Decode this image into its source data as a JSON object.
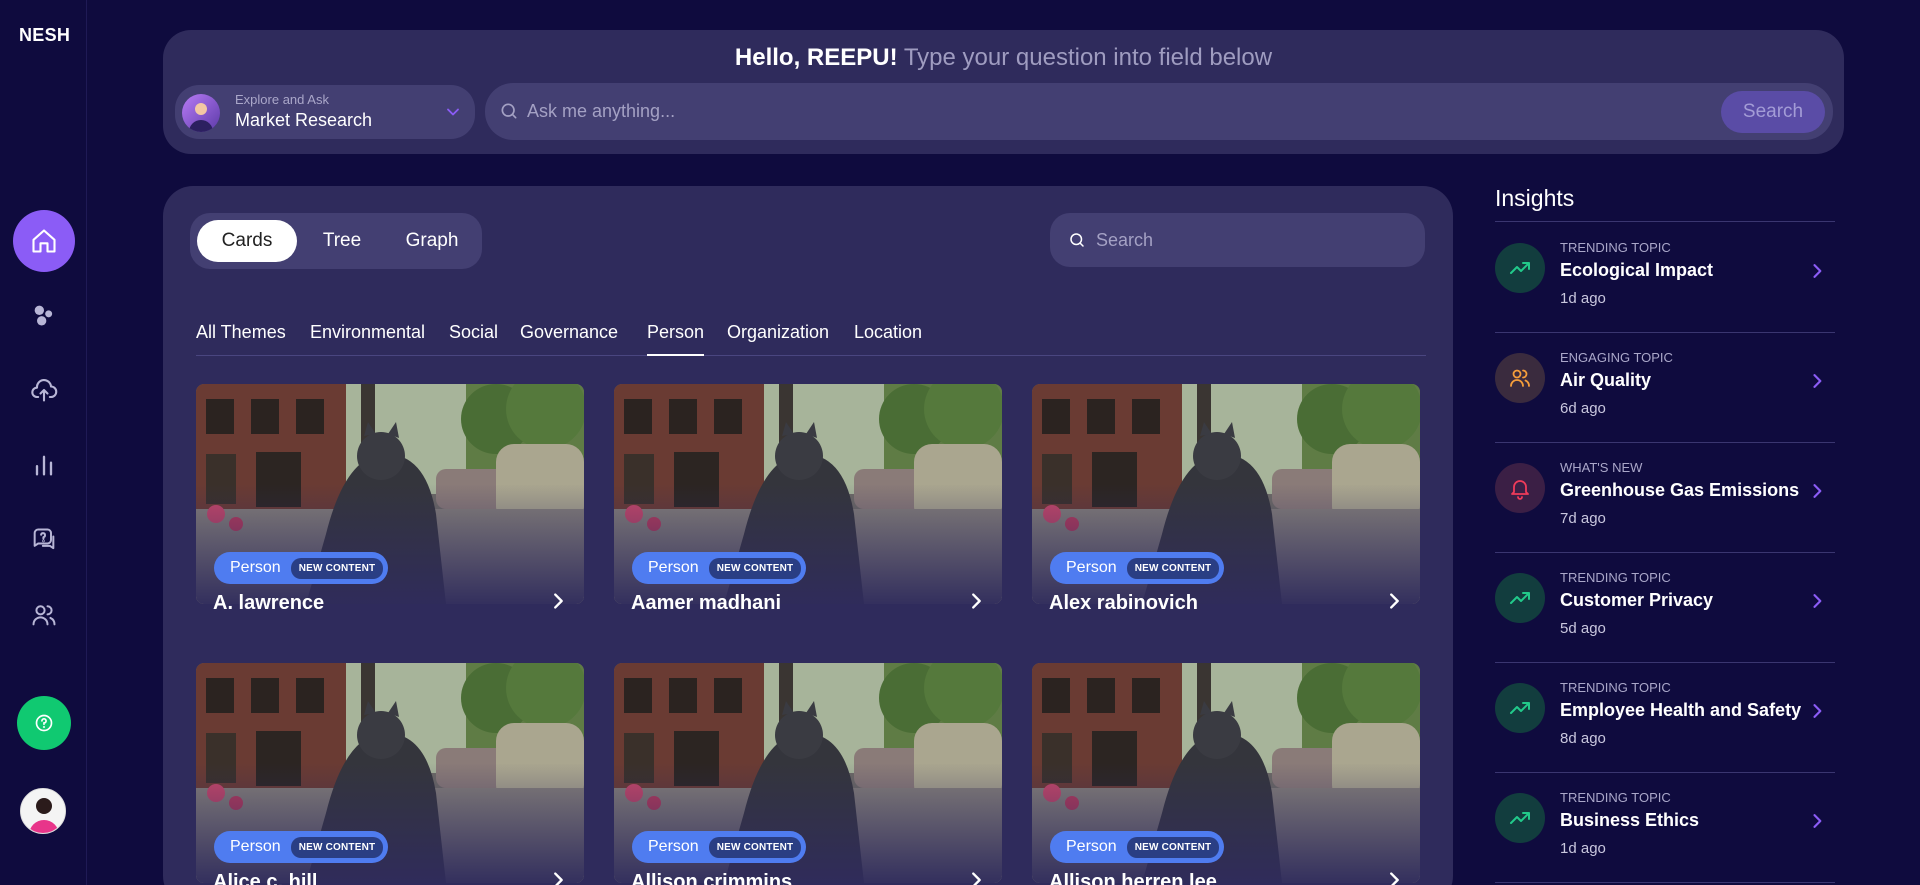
{
  "app": {
    "logo": "NESH"
  },
  "sidebar": {
    "items": [
      {
        "name": "home",
        "icon": "home-icon",
        "active": true
      },
      {
        "name": "topics",
        "icon": "bubbles-icon"
      },
      {
        "name": "upload",
        "icon": "cloud-upload-icon"
      },
      {
        "name": "analytics",
        "icon": "bar-chart-icon"
      },
      {
        "name": "questions",
        "icon": "question-chat-icon"
      },
      {
        "name": "users",
        "icon": "users-icon"
      }
    ],
    "help_icon": "help-icon",
    "accent": "#8b5cf6",
    "help_color": "#10c971"
  },
  "header": {
    "greeting_hello": "Hello, REEPU!",
    "greeting_sub": "Type your question into field below",
    "context_label": "Explore and Ask",
    "context_value": "Market Research",
    "ask_placeholder": "Ask me anything...",
    "ask_button": "Search"
  },
  "main": {
    "views": [
      {
        "label": "Cards",
        "active": true
      },
      {
        "label": "Tree"
      },
      {
        "label": "Graph"
      }
    ],
    "search_placeholder": "Search",
    "themes": [
      {
        "label": "All Themes"
      },
      {
        "label": "Environmental"
      },
      {
        "label": "Social"
      },
      {
        "label": "Governance"
      },
      {
        "label": "Person",
        "active": true
      },
      {
        "label": "Organization"
      },
      {
        "label": "Location"
      }
    ],
    "cards": [
      {
        "type": "Person",
        "badge": "NEW CONTENT",
        "title": "A. lawrence"
      },
      {
        "type": "Person",
        "badge": "NEW CONTENT",
        "title": "Aamer madhani"
      },
      {
        "type": "Person",
        "badge": "NEW CONTENT",
        "title": "Alex rabinovich"
      },
      {
        "type": "Person",
        "badge": "NEW CONTENT",
        "title": "Alice c. hill"
      },
      {
        "type": "Person",
        "badge": "NEW CONTENT",
        "title": "Allison crimmins"
      },
      {
        "type": "Person",
        "badge": "NEW CONTENT",
        "title": "Allison herren lee"
      }
    ]
  },
  "insights": {
    "title": "Insights",
    "items": [
      {
        "kind": "TRENDING TOPIC",
        "name": "Ecological Impact",
        "time": "1d ago",
        "icon": "trending-up-icon",
        "color": "#22c98a"
      },
      {
        "kind": "ENGAGING TOPIC",
        "name": "Air Quality",
        "time": "6d ago",
        "icon": "users-icon",
        "color": "#f59e3b"
      },
      {
        "kind": "WHAT'S NEW",
        "name": "Greenhouse Gas Emissions",
        "time": "7d ago",
        "icon": "bell-icon",
        "color": "#ef3b5a"
      },
      {
        "kind": "TRENDING TOPIC",
        "name": "Customer Privacy",
        "time": "5d ago",
        "icon": "trending-up-icon",
        "color": "#22c98a"
      },
      {
        "kind": "TRENDING TOPIC",
        "name": "Employee Health and Safety",
        "time": "8d ago",
        "icon": "trending-up-icon",
        "color": "#22c98a"
      },
      {
        "kind": "TRENDING TOPIC",
        "name": "Business Ethics",
        "time": "1d ago",
        "icon": "trending-up-icon",
        "color": "#22c98a"
      }
    ]
  }
}
